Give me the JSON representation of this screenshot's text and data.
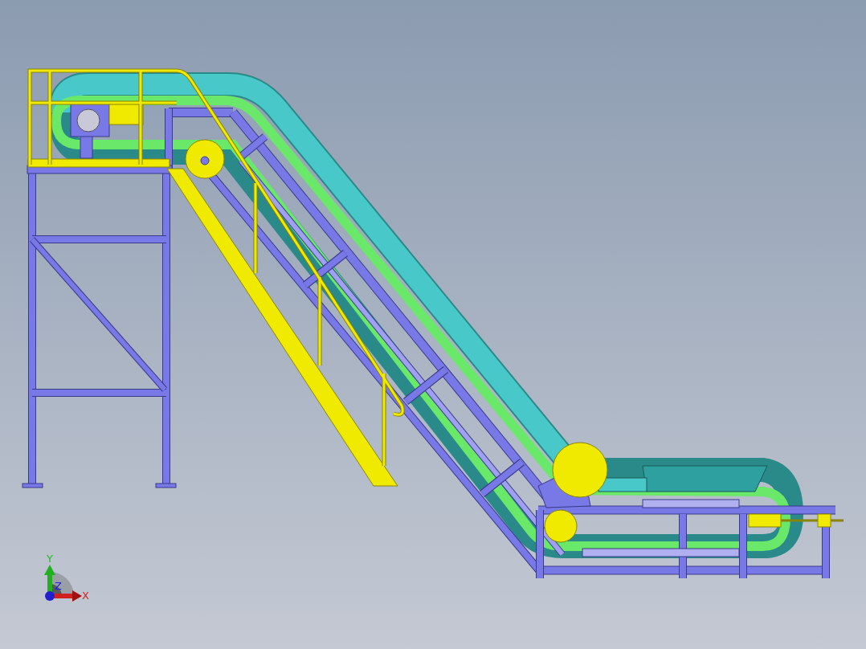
{
  "viewport": {
    "axes": [
      {
        "kind": "y",
        "label": "Y"
      },
      {
        "kind": "x",
        "label": "X"
      },
      {
        "kind": "z",
        "label": "Z"
      }
    ]
  }
}
